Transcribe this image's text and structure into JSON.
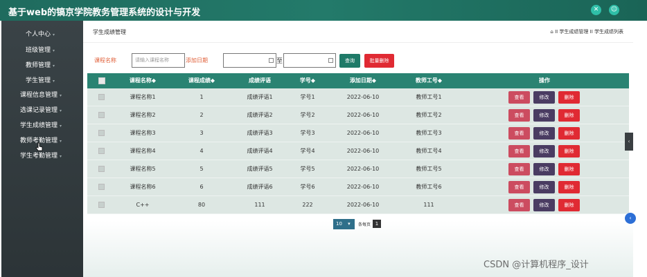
{
  "app": {
    "title": "基于web的镐京学院教务管理系统的设计与开发"
  },
  "sidebar": {
    "items": [
      {
        "label": "个人中心"
      },
      {
        "label": "班级管理"
      },
      {
        "label": "教师管理"
      },
      {
        "label": "学生管理"
      },
      {
        "label": "课程信息管理"
      },
      {
        "label": "选课记录管理"
      },
      {
        "label": "学生成绩管理"
      },
      {
        "label": "教师考勤管理"
      },
      {
        "label": "学生考勤管理"
      }
    ]
  },
  "page": {
    "title": "学生成绩管理",
    "breadcrumb": "II 学生成绩管理 II 学生成绩列表"
  },
  "search": {
    "course_label": "课程名称",
    "course_placeholder": "请输入课程名称",
    "date_label": "添加日期",
    "to_text": "至",
    "query_label": "查询",
    "batch_delete_label": "批量删除"
  },
  "table": {
    "headers": [
      "课程名称◆",
      "课程成绩◆",
      "成绩评语",
      "学号◆",
      "添加日期◆",
      "教师工号◆",
      "操作"
    ],
    "actions": {
      "view": "查看",
      "edit": "修改",
      "delete": "删除"
    },
    "rows": [
      [
        "课程名称1",
        "1",
        "成绩评语1",
        "学号1",
        "2022-06-10",
        "教师工号1"
      ],
      [
        "课程名称2",
        "2",
        "成绩评语2",
        "学号2",
        "2022-06-10",
        "教师工号2"
      ],
      [
        "课程名称3",
        "3",
        "成绩评语3",
        "学号3",
        "2022-06-10",
        "教师工号3"
      ],
      [
        "课程名称4",
        "4",
        "成绩评语4",
        "学号4",
        "2022-06-10",
        "教师工号4"
      ],
      [
        "课程名称5",
        "5",
        "成绩评语5",
        "学号5",
        "2022-06-10",
        "教师工号5"
      ],
      [
        "课程名称6",
        "6",
        "成绩评语6",
        "学号6",
        "2022-06-10",
        "教师工号6"
      ],
      [
        "C++",
        "80",
        "111",
        "222",
        "2022-06-10",
        "111"
      ]
    ]
  },
  "pager": {
    "page_size": "10",
    "per_page_label": "条每页",
    "current_page": "1"
  },
  "watermark": "CSDN @计算机程序_设计",
  "colors": {
    "header_bg": "#1f6b5e",
    "table_header": "#2a8372",
    "view_button": "#cc4c60",
    "edit_button": "#4a3c62",
    "delete_button": "#e02a33",
    "query_button": "#1f7a68"
  },
  "icons": {
    "top_right": [
      "expand-icon",
      "user-icon"
    ],
    "breadcrumb": "home-icon"
  }
}
